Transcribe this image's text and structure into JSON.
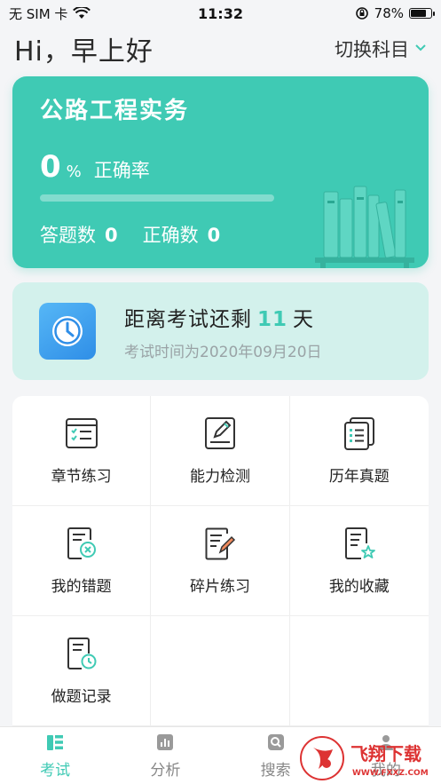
{
  "status": {
    "carrier": "无 SIM 卡",
    "time": "11:32",
    "battery": "78%",
    "battery_level": 0.78
  },
  "header": {
    "greeting": "Hi，早上好",
    "switch_label": "切换科目"
  },
  "main_card": {
    "title": "公路工程实务",
    "rate_value": "0",
    "rate_unit": "%",
    "rate_label": "正确率",
    "progress": 0.0,
    "answered_label": "答题数",
    "answered_value": "0",
    "correct_label": "正确数",
    "correct_value": "0",
    "accent": "#3fcab4"
  },
  "countdown": {
    "prefix": "距离考试还剩",
    "days": "11",
    "suffix": "天",
    "date_text": "考试时间为2020年09月20日"
  },
  "grid": {
    "items": [
      {
        "label": "章节练习",
        "icon": "chapter-practice-icon"
      },
      {
        "label": "能力检测",
        "icon": "ability-test-icon"
      },
      {
        "label": "历年真题",
        "icon": "past-exams-icon"
      },
      {
        "label": "我的错题",
        "icon": "wrong-questions-icon"
      },
      {
        "label": "碎片练习",
        "icon": "fragment-practice-icon"
      },
      {
        "label": "我的收藏",
        "icon": "favorites-icon"
      },
      {
        "label": "做题记录",
        "icon": "records-icon"
      }
    ]
  },
  "tabbar": {
    "tabs": [
      {
        "label": "考试",
        "icon": "exam-icon",
        "active": true
      },
      {
        "label": "分析",
        "icon": "chart-icon",
        "active": false
      },
      {
        "label": "搜索",
        "icon": "search-icon",
        "active": false
      },
      {
        "label": "我的",
        "icon": "profile-icon",
        "active": false
      }
    ]
  },
  "watermark": {
    "text": "飞翔下载",
    "url_text": "WWW.FXXZ.COM"
  }
}
